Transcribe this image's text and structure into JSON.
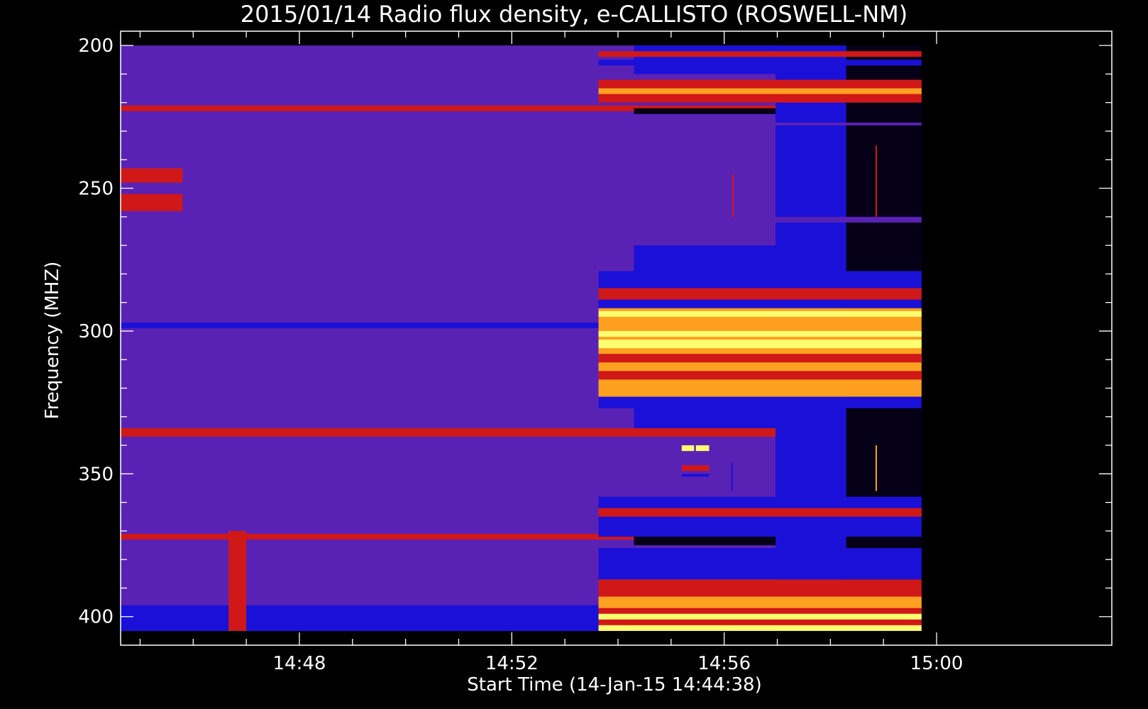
{
  "chart_data": {
    "type": "heatmap",
    "title": "2015/01/14  Radio flux density, e-CALLISTO (ROSWELL-NM)",
    "xlabel": "Start Time (14-Jan-15 14:44:38)",
    "ylabel": "Frequency (MHZ)",
    "x_ticks": [
      "14:48",
      "14:52",
      "14:56",
      "15:00"
    ],
    "y_ticks": [
      "200",
      "250",
      "300",
      "350",
      "400"
    ],
    "x_range_min": [
      0,
      1120
    ],
    "data_x_range_min": [
      0,
      905
    ],
    "y_range_mhz": [
      195,
      410
    ],
    "data_y_range_mhz": [
      200,
      405
    ],
    "y_inverted": true,
    "grid": false,
    "colormap": [
      "#000000",
      "#1a10d8",
      "#5a22b4",
      "#8b1a78",
      "#d01818",
      "#ffa020",
      "#ffff70"
    ],
    "regions": [
      {
        "t": [
          0,
          740
        ],
        "f": [
          200,
          405
        ],
        "level": "purple"
      },
      {
        "t": [
          740,
          820
        ],
        "f": [
          200,
          405
        ],
        "level": "blue"
      },
      {
        "t": [
          820,
          905
        ],
        "f": [
          200,
          405
        ],
        "level": "dark"
      }
    ],
    "bands": [
      {
        "t": [
          0,
          740
        ],
        "f": [
          221,
          223
        ],
        "level": "red"
      },
      {
        "t": [
          0,
          740
        ],
        "f": [
          297,
          299
        ],
        "level": "blue"
      },
      {
        "t": [
          0,
          740
        ],
        "f": [
          334,
          337
        ],
        "level": "red"
      },
      {
        "t": [
          0,
          740
        ],
        "f": [
          371,
          373
        ],
        "level": "red"
      },
      {
        "t": [
          0,
          740
        ],
        "f": [
          396,
          405
        ],
        "level": "blue"
      },
      {
        "t": [
          0,
          70
        ],
        "f": [
          243,
          248
        ],
        "level": "red"
      },
      {
        "t": [
          0,
          70
        ],
        "f": [
          252,
          258
        ],
        "level": "red"
      },
      {
        "t": [
          122,
          142
        ],
        "f": [
          370,
          405
        ],
        "level": "red"
      },
      {
        "t": [
          543,
          573
        ],
        "f": [
          395,
          405
        ],
        "level": "red"
      },
      {
        "t": [
          580,
          740
        ],
        "f": [
          222,
          224
        ],
        "level": "dark"
      },
      {
        "t": [
          580,
          740
        ],
        "f": [
          371,
          375
        ],
        "level": "dark"
      },
      {
        "t": [
          580,
          740
        ],
        "f": [
          270,
          280
        ],
        "level": "blue"
      },
      {
        "t": [
          580,
          740
        ],
        "f": [
          322,
          334
        ],
        "level": "blue"
      },
      {
        "t": [
          580,
          740
        ],
        "f": [
          200,
          210
        ],
        "level": "blue"
      },
      {
        "t": [
          540,
          905
        ],
        "f": [
          202,
          204
        ],
        "level": "red"
      },
      {
        "t": [
          540,
          905
        ],
        "f": [
          205,
          207
        ],
        "level": "blue"
      },
      {
        "t": [
          540,
          905
        ],
        "f": [
          212,
          220
        ],
        "level": "red"
      },
      {
        "t": [
          540,
          905
        ],
        "f": [
          215,
          217
        ],
        "level": "orange"
      },
      {
        "t": [
          540,
          905
        ],
        "f": [
          227,
          228
        ],
        "level": "purple"
      },
      {
        "t": [
          605,
          905
        ],
        "f": [
          260,
          262
        ],
        "level": "purple"
      },
      {
        "t": [
          540,
          905
        ],
        "f": [
          279,
          292
        ],
        "level": "blue"
      },
      {
        "t": [
          540,
          905
        ],
        "f": [
          285,
          289
        ],
        "level": "red"
      },
      {
        "t": [
          540,
          905
        ],
        "f": [
          292,
          323
        ],
        "level": "orange"
      },
      {
        "t": [
          540,
          905
        ],
        "f": [
          293,
          295
        ],
        "level": "yellow"
      },
      {
        "t": [
          540,
          905
        ],
        "f": [
          300,
          302
        ],
        "level": "yellow"
      },
      {
        "t": [
          540,
          905
        ],
        "f": [
          303,
          306
        ],
        "level": "yellow"
      },
      {
        "t": [
          540,
          905
        ],
        "f": [
          308,
          311
        ],
        "level": "red"
      },
      {
        "t": [
          540,
          905
        ],
        "f": [
          314,
          317
        ],
        "level": "red"
      },
      {
        "t": [
          540,
          905
        ],
        "f": [
          323,
          327
        ],
        "level": "blue"
      },
      {
        "t": [
          540,
          905
        ],
        "f": [
          358,
          372
        ],
        "level": "blue"
      },
      {
        "t": [
          540,
          905
        ],
        "f": [
          362,
          365
        ],
        "level": "red"
      },
      {
        "t": [
          540,
          905
        ],
        "f": [
          376,
          387
        ],
        "level": "blue"
      },
      {
        "t": [
          540,
          905
        ],
        "f": [
          387,
          405
        ],
        "level": "red"
      },
      {
        "t": [
          540,
          905
        ],
        "f": [
          393,
          397
        ],
        "level": "orange"
      },
      {
        "t": [
          540,
          905
        ],
        "f": [
          399,
          401
        ],
        "level": "yellow"
      },
      {
        "t": [
          540,
          905
        ],
        "f": [
          403,
          405
        ],
        "level": "yellow"
      },
      {
        "t": [
          634,
          648
        ],
        "f": [
          340,
          342
        ],
        "level": "yellow"
      },
      {
        "t": [
          650,
          665
        ],
        "f": [
          340,
          342
        ],
        "level": "yellow"
      },
      {
        "t": [
          634,
          665
        ],
        "f": [
          347,
          349
        ],
        "level": "red"
      },
      {
        "t": [
          634,
          665
        ],
        "f": [
          350,
          351
        ],
        "level": "blue"
      }
    ],
    "spikes": [
      {
        "t": 853,
        "f": [
          235,
          260
        ],
        "level": "red"
      },
      {
        "t": 818,
        "f": [
          245,
          260
        ],
        "level": "blue"
      },
      {
        "t": 691,
        "f": [
          245,
          260
        ],
        "level": "red"
      },
      {
        "t": 853,
        "f": [
          340,
          356
        ],
        "level": "orange"
      },
      {
        "t": 690,
        "f": [
          346,
          356
        ],
        "level": "blue"
      },
      {
        "t": 808,
        "f": [
          250,
          256
        ],
        "level": "blue"
      }
    ]
  }
}
